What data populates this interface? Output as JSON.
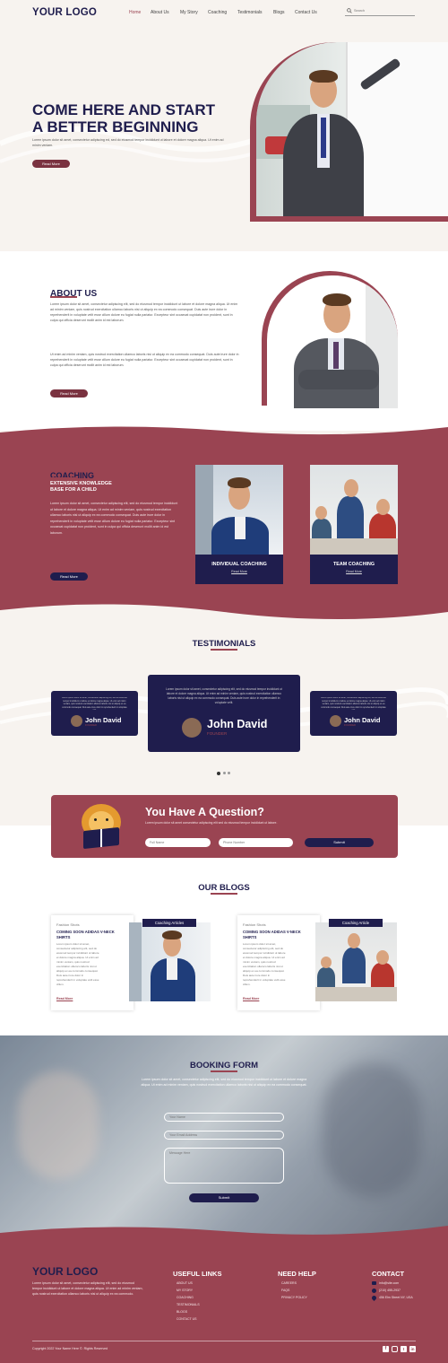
{
  "header": {
    "logo": "YOUR LOGO",
    "nav": [
      "Home",
      "About Us",
      "My Story",
      "Coaching",
      "Testimonials",
      "Blogs",
      "Contact Us"
    ],
    "search_placeholder": "Search"
  },
  "hero": {
    "title_line1": "COME HERE AND START",
    "title_line2": "A BETTER BEGINNING",
    "text": "Lorem ipsum dolor sit amet, consectetur adipiscing ed, sed do eiusmod tempor incididunt ut labore et dolore magna aliqua. Ut enim ad minim veniam.",
    "button": "Read More"
  },
  "about": {
    "heading": "ABOUT US",
    "para1": "Lorem ipsum dolor sit amet, consectetur adipiscing elit, sed do eiusmod tempor incididunt ut labore et dolore magna aliqua. Ut enim ad minim veniam, quis nostrud exercitation ullamco laboris nisi ut aliquip ex ea commodo consequat. Duis aute irure dolor in reprehenderit in voluptate velit esse cillum dolore eu fugiat nulla pariatur. Excepteur sint occaecat cupidatat non proident, sunt in culpa qui officia deserunt mollit anim id est laborum.",
    "para2": "Ut enim ad minim veniam, quis nostrud exercitation ullamco laboris nisi ut aliquip ex ea commodo consequat. Duis aute irure dolor in reprehenderit in voluptate velit esse cillum dolore eu fugiat nulla pariatur. Excepteur sint occaecat cupidatat non proident, sunt in culpa qui officia deserunt mollit anim id est laborum.",
    "button": "Read More"
  },
  "coaching": {
    "heading": "COACHING",
    "subheading_line1": "EXTENSIVE KNOWLEDGE",
    "subheading_line2": "BASE FOR A CHILD",
    "text": "Lorem ipsum dolor sit amet, consectetur adipiscing elit, sed do eiusmod tempor incididunt ut labore et dolore magna aliqua. Ut enim ad minim veniam, quis nostrud exercitation ullamco laboris nisi ut aliquip ex ea commodo consequat. Duis aute irure dolor in reprehenderit in voluptate velit esse cillum dolore eu fugiat nulla pariatur. Excepteur sint occaecat cupidatat non proident, sunt in culpa qui officia deserunt mollit anim id est laborum.",
    "button": "Read More",
    "cards": [
      {
        "title": "INDIVIDUAL COACHING",
        "link": "Read More"
      },
      {
        "title": "TEAM COACHING",
        "link": "Read More"
      }
    ]
  },
  "testimonials": {
    "heading": "TESTIMONIALS",
    "quote": "Lorem ipsum dolor sit amet, consectetur adipiscing elit, sed do eiusmod tempor incididunt ut labore et dolore magna aliqua. Ut enim ad minim veniam, quis nostrud exercitation ullamco laboris nisi ut aliquip ex ea commodo consequat. Duis aute irure dolor in reprehenderit in voluptate velit.",
    "name": "John David",
    "role": "FOUNDER"
  },
  "question": {
    "heading": "You Have A Question?",
    "text": "Lorem ipsum dolor sit amet consectetur adipiscing elit sed do eiusmod tempor incididunt ut labore.",
    "name_placeholder": "Full Name",
    "phone_placeholder": "Phone Number",
    "submit": "Submit"
  },
  "blogs": {
    "heading": "OUR BLOGS",
    "posts": [
      {
        "category": "Fashion Shots",
        "title_line1": "COMING SOON ADIDAS V-NECK",
        "title_line2": "SHIRTS",
        "text": "Lorem ipsum dolor sit amet, consectetur adipiscing elit, sed do eiusmod tempor incididunt ut labore et dolore magna aliqua. Ut enim ad minim veniam, quis nostrud exercitation ullamco laboris nisi ut aliquip ex ea commodo consequat. Duis aute irure dolor in reprehenderit in voluptate velit esse cillum.",
        "link": "Read More",
        "tag": "Coaching Articles"
      },
      {
        "category": "Fashion Shots",
        "title_line1": "COMING SOON ADIDAS V-NECK",
        "title_line2": "SHIRTS",
        "text": "Lorem ipsum dolor sit amet, consectetur adipiscing elit, sed do eiusmod tempor incididunt ut labore et dolore magna aliqua. Ut enim ad minim veniam, quis nostrud exercitation ullamco laboris nisi ut aliquip ex ea commodo consequat. Duis aute irure dolor in reprehenderit in voluptate velit esse cillum.",
        "link": "Read More",
        "tag": "Coaching Article"
      }
    ]
  },
  "booking": {
    "heading": "BOOKING FORM",
    "text": "Lorem ipsum dolor sit amet, consectetur adipiscing elit, sed do eiusmod tempor incididunt ut labore et dolore magna aliqua. Ut enim ad minim veniam, quis nostrud exercitation ullamco laboris nisi ut aliquip ex ea commodo consequat.",
    "name_placeholder": "Your Name",
    "email_placeholder": "Your Email Address",
    "message_placeholder": "Message Here",
    "submit": "Submit"
  },
  "footer": {
    "logo": "YOUR LOGO",
    "text": "Lorem ipsum dolor sit amet, consectetur adipiscing elit, sed do eiusmod tempor incididunt ut labore et dolore magna aliqua. Ut enim ad minim veniam, quis nostrud exercitation ullamco laboris nisi ut aliquip ex ea commodo.",
    "useful_links_heading": "USEFUL LINKS",
    "useful_links": [
      "ABOUT US",
      "MY STORY",
      "COACHING",
      "TESTIMONIALS",
      "BLOGS",
      "CONTACT US"
    ],
    "need_help_heading": "NEED HELP",
    "need_help": [
      "CAREERS",
      "FAQS",
      "PRIVACY POLICY"
    ],
    "contact_heading": "CONTACT",
    "contact": [
      "info@site.com",
      "(210) 455-2937",
      "456 Elm Street NY, USA"
    ],
    "copyright": "Copyright 2022 Your Name Here ©. Rights Reserved"
  },
  "colors": {
    "navy": "#1f1d4d",
    "maroon": "#9a4452",
    "cream": "#f7f3ef"
  }
}
